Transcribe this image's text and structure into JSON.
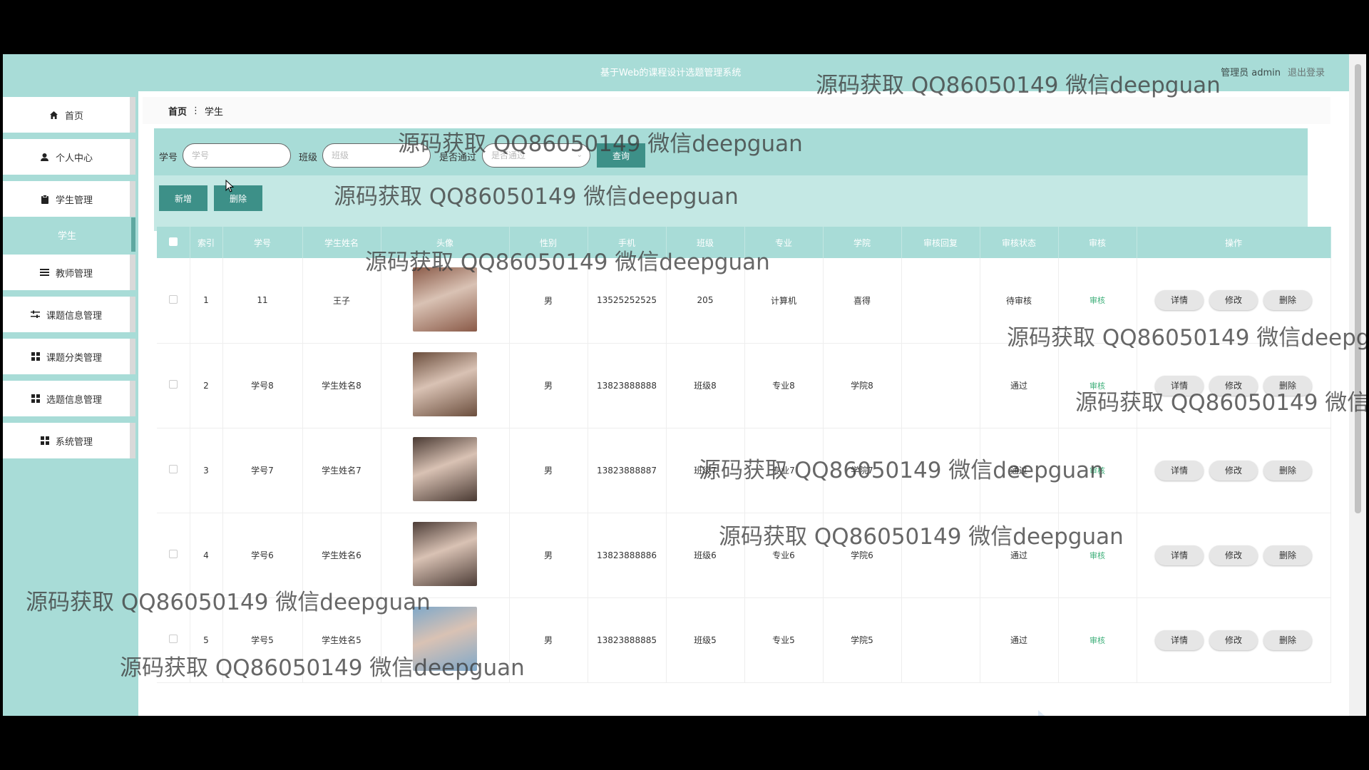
{
  "header": {
    "title": "基于Web的课程设计选题管理系统",
    "admin_label": "管理员 admin",
    "logout": "退出登录"
  },
  "sidebar": {
    "items": [
      {
        "label": "首页",
        "icon": "home-icon"
      },
      {
        "label": "个人中心",
        "icon": "user-icon"
      },
      {
        "label": "学生管理",
        "icon": "clipboard-icon"
      },
      {
        "label": "学生",
        "icon": ""
      },
      {
        "label": "教师管理",
        "icon": "list-icon"
      },
      {
        "label": "课题信息管理",
        "icon": "sliders-icon"
      },
      {
        "label": "课题分类管理",
        "icon": "grid-icon"
      },
      {
        "label": "选题信息管理",
        "icon": "grid-icon"
      },
      {
        "label": "系统管理",
        "icon": "grid-icon"
      }
    ]
  },
  "breadcrumb": {
    "home": "首页",
    "separator": "⋮",
    "current": "学生"
  },
  "search": {
    "student_id_label": "学号",
    "student_id_placeholder": "学号",
    "class_label": "班级",
    "class_placeholder": "班级",
    "passed_label": "是否通过",
    "passed_placeholder": "是否通过",
    "query_button": "查询",
    "add_button": "新增",
    "delete_button": "删除"
  },
  "table": {
    "headers": [
      "索引",
      "学号",
      "学生姓名",
      "头像",
      "性别",
      "手机",
      "班级",
      "专业",
      "学院",
      "审核回复",
      "审核状态",
      "审核",
      "操作"
    ],
    "audit_link": "审核",
    "op_buttons": [
      "详情",
      "修改",
      "删除"
    ],
    "rows": [
      {
        "index": "1",
        "student_id": "11",
        "name": "王子",
        "gender": "男",
        "phone": "13525252525",
        "class": "205",
        "major": "计算机",
        "college": "喜得",
        "reply": "",
        "status": "待审核",
        "avatar_color": "#8a5a48"
      },
      {
        "index": "2",
        "student_id": "学号8",
        "name": "学生姓名8",
        "gender": "男",
        "phone": "13823888888",
        "class": "班级8",
        "major": "专业8",
        "college": "学院8",
        "reply": "",
        "status": "通过",
        "avatar_color": "#6b4e3d"
      },
      {
        "index": "3",
        "student_id": "学号7",
        "name": "学生姓名7",
        "gender": "男",
        "phone": "13823888887",
        "class": "班级7",
        "major": "专业7",
        "college": "学院7",
        "reply": "",
        "status": "通过",
        "avatar_color": "#4a3a33"
      },
      {
        "index": "4",
        "student_id": "学号6",
        "name": "学生姓名6",
        "gender": "男",
        "phone": "13823888886",
        "class": "班级6",
        "major": "专业6",
        "college": "学院6",
        "reply": "",
        "status": "通过",
        "avatar_color": "#4d3d37"
      },
      {
        "index": "5",
        "student_id": "学号5",
        "name": "学生姓名5",
        "gender": "男",
        "phone": "13823888885",
        "class": "班级5",
        "major": "专业5",
        "college": "学院5",
        "reply": "",
        "status": "通过",
        "avatar_color": "#7fa8c9"
      }
    ]
  },
  "watermark": "源码获取 QQ86050149 微信deepguan",
  "colors": {
    "theme": "#a8dcd7",
    "theme_dark": "#3d9088",
    "audit_green": "#3fb07a"
  }
}
